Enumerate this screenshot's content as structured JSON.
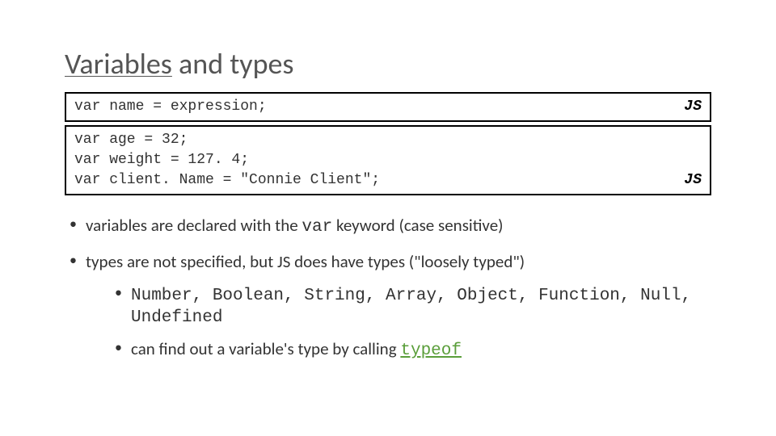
{
  "title": {
    "underlined": "Variables",
    "rest": " and types"
  },
  "syntax_box": {
    "line": "var name = expression;",
    "badge": "JS"
  },
  "example_box": {
    "lines": [
      "var age = 32;",
      "var weight = 127. 4;",
      "var client. Name = \"Connie Client\";"
    ],
    "badge": "JS"
  },
  "bullet1": {
    "pre": "variables are declared with the ",
    "kw": "var",
    "post": " keyword (case sensitive)"
  },
  "bullet2": {
    "text": "types are not specified, but JS does have types (\"loosely typed\")"
  },
  "subbullet1": {
    "types": [
      "Number",
      "Boolean",
      "String",
      "Array",
      "Object",
      "Function",
      "Null",
      "Undefined"
    ],
    "joined": "Number, Boolean, String, Array, Object, Function, Null, Undefined"
  },
  "subbullet2": {
    "pre": "can find out a variable's type by calling ",
    "fn": "typeof"
  }
}
